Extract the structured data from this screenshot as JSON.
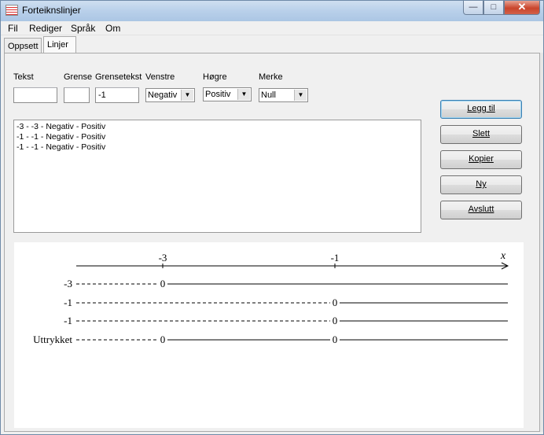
{
  "window": {
    "title": "Forteiknslinjer",
    "controls": {
      "minimize": "—",
      "maximize": "□",
      "close": "✕"
    }
  },
  "menu": [
    "Fil",
    "Rediger",
    "Språk",
    "Om"
  ],
  "tabs": [
    {
      "label": "Oppsett",
      "active": false
    },
    {
      "label": "Linjer",
      "active": true
    }
  ],
  "form": {
    "tekst": {
      "label": "Tekst",
      "value": ""
    },
    "grense": {
      "label": "Grense",
      "value": ""
    },
    "grensetekst": {
      "label": "Grensetekst",
      "value": "-1"
    },
    "venstre": {
      "label": "Venstre",
      "value": "Negativ"
    },
    "hogre": {
      "label": "Høgre",
      "value": "Positiv"
    },
    "merke": {
      "label": "Merke",
      "value": "Null"
    }
  },
  "list_items": [
    "-3 - -3 - Negativ - Positiv",
    "-1 - -1 - Negativ - Positiv",
    "-1 - -1 - Negativ - Positiv"
  ],
  "buttons": {
    "legg_til": "Legg til",
    "slett": "Slett",
    "kopier": "Kopier",
    "ny": "Ny",
    "avslutt": "Avslutt"
  },
  "sign_chart": {
    "axis_variable": "x",
    "axis_ticks": [
      "-3",
      "-1"
    ],
    "rows": [
      {
        "label": "-3",
        "zeros": [
          "0"
        ]
      },
      {
        "label": "-1",
        "zeros": [
          "0"
        ]
      },
      {
        "label": "-1",
        "zeros": [
          "0"
        ]
      },
      {
        "label": "Uttrykket",
        "zeros": [
          "0",
          "0"
        ]
      }
    ],
    "notes": {
      "row_1": "negative (dashed) left of -3, positive (solid) right of -3",
      "row_2": "negative (dashed) left of -1, positive (solid) right of -1",
      "row_3": "negative (dashed) left of -1, positive (solid) right of -1",
      "row_4": "negative left of -3, positive between -3 and -1, positive right of -1"
    }
  }
}
